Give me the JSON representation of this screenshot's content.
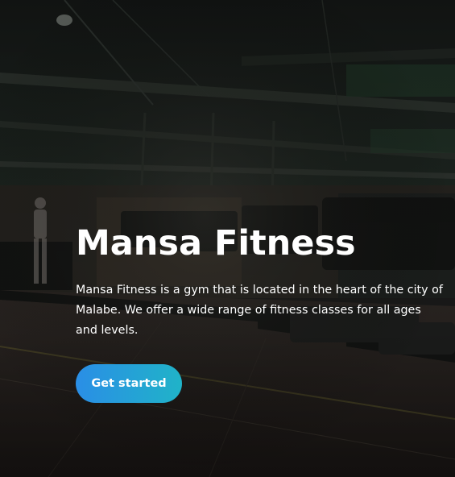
{
  "hero": {
    "title": "Mansa Fitness",
    "description": "Mansa Fitness is a gym that is located in the heart of the city of Malabe. We offer a wide range of fitness classes for all ages and levels.",
    "cta_label": "Get started"
  },
  "colors": {
    "overlay": "#000000",
    "button_gradient_start": "#2a8ee6",
    "button_gradient_end": "#20b3c8",
    "text": "#ffffff"
  }
}
